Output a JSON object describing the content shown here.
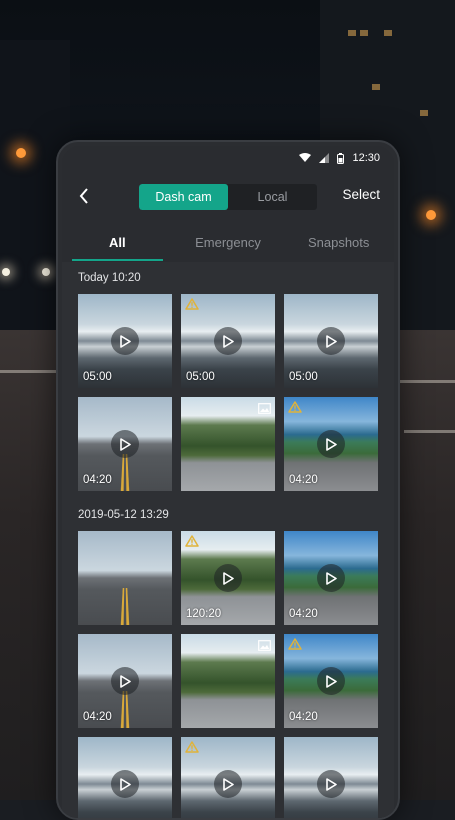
{
  "status": {
    "time": "12:30"
  },
  "header": {
    "segments": [
      "Dash cam",
      "Local"
    ],
    "select_label": "Select"
  },
  "tabs": [
    "All",
    "Emergency",
    "Snapshots"
  ],
  "groups": [
    {
      "title": "Today 10:20",
      "items": [
        {
          "scene": "mountain",
          "duration": "05:00",
          "play": true,
          "warning": false,
          "photo": false
        },
        {
          "scene": "mountain",
          "duration": "05:00",
          "play": true,
          "warning": true,
          "photo": false
        },
        {
          "scene": "mountain",
          "duration": "05:00",
          "play": true,
          "warning": false,
          "photo": false
        },
        {
          "scene": "road",
          "duration": "04:20",
          "play": true,
          "warning": false,
          "photo": false
        },
        {
          "scene": "valley",
          "duration": "",
          "play": false,
          "warning": false,
          "photo": true
        },
        {
          "scene": "coast",
          "duration": "04:20",
          "play": true,
          "warning": true,
          "photo": false
        }
      ]
    },
    {
      "title": "2019-05-12 13:29",
      "items": [
        {
          "scene": "road",
          "duration": "",
          "play": false,
          "warning": false,
          "photo": false
        },
        {
          "scene": "valley",
          "duration": "120:20",
          "play": true,
          "warning": true,
          "photo": false
        },
        {
          "scene": "coast",
          "duration": "04:20",
          "play": true,
          "warning": false,
          "photo": false
        },
        {
          "scene": "road",
          "duration": "04:20",
          "play": true,
          "warning": false,
          "photo": false
        },
        {
          "scene": "valley",
          "duration": "",
          "play": false,
          "warning": false,
          "photo": true
        },
        {
          "scene": "coast",
          "duration": "04:20",
          "play": true,
          "warning": true,
          "photo": false
        },
        {
          "scene": "mountain",
          "duration": "",
          "play": true,
          "warning": false,
          "photo": false
        },
        {
          "scene": "mountain",
          "duration": "",
          "play": true,
          "warning": true,
          "photo": false
        },
        {
          "scene": "mountain",
          "duration": "",
          "play": true,
          "warning": false,
          "photo": false
        }
      ]
    }
  ],
  "colors": {
    "accent": "#14a58a",
    "warning": "#e0b33a"
  }
}
